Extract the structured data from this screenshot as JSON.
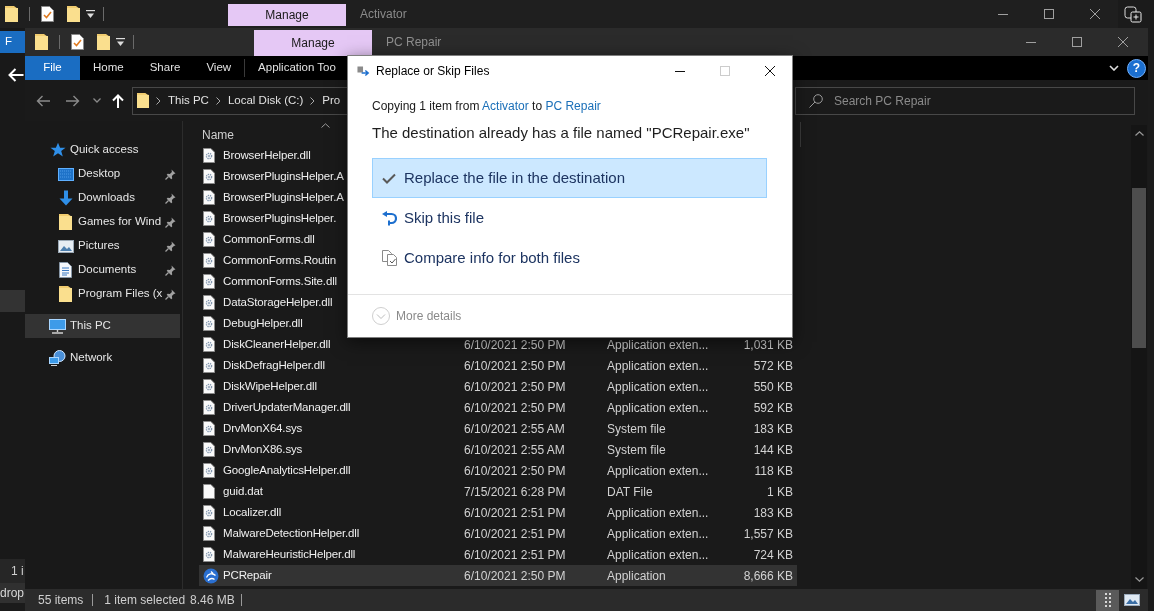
{
  "back_window": {
    "title": "Activator",
    "context_tab": "Manage",
    "ribbon_tab": "F",
    "status_text": "1 i"
  },
  "desktop": {
    "text": "drop"
  },
  "window": {
    "title": "PC Repair",
    "context_tab": "Manage",
    "ribbon_tabs": [
      {
        "label": "File",
        "kind": "menu"
      },
      {
        "label": "Home",
        "kind": "tab"
      },
      {
        "label": "Share",
        "kind": "tab"
      },
      {
        "label": "View",
        "kind": "tab"
      },
      {
        "label": "Application Too",
        "kind": "tab"
      }
    ],
    "help": "?",
    "breadcrumb": [
      "This PC",
      "Local Disk (C:)",
      "Pro"
    ],
    "search": {
      "placeholder": "Search PC Repair"
    },
    "nav": [
      {
        "label": "Quick access",
        "kind": "star",
        "selected": false,
        "children": [
          {
            "label": "Desktop",
            "kind": "desktop",
            "pinned": true,
            "selected": false
          },
          {
            "label": "Downloads",
            "kind": "downloads",
            "pinned": true,
            "selected": false
          },
          {
            "label": "Games for Wind",
            "kind": "folder",
            "pinned": true,
            "selected": false
          },
          {
            "label": "Pictures",
            "kind": "pictures",
            "pinned": true,
            "selected": false
          },
          {
            "label": "Documents",
            "kind": "documents",
            "pinned": true,
            "selected": false
          },
          {
            "label": "Program Files (x",
            "kind": "folder",
            "pinned": true,
            "selected": false
          }
        ]
      },
      {
        "label": "This PC",
        "kind": "computer",
        "selected": true
      },
      {
        "label": "Network",
        "kind": "network",
        "selected": false
      }
    ],
    "table": {
      "columns": [
        {
          "label": "Name",
          "ascending": true
        }
      ],
      "rows": [
        {
          "name": "BrowserHelper.dll",
          "kind": "extension",
          "selected": false
        },
        {
          "name": "BrowserPluginsHelper.A",
          "kind": "extension",
          "selected": false
        },
        {
          "name": "BrowserPluginsHelper.A",
          "kind": "extension",
          "selected": false
        },
        {
          "name": "BrowserPluginsHelper.",
          "kind": "extension",
          "selected": false
        },
        {
          "name": "CommonForms.dll",
          "kind": "extension",
          "selected": false
        },
        {
          "name": "CommonForms.Routin",
          "kind": "extension",
          "selected": false
        },
        {
          "name": "CommonForms.Site.dll",
          "kind": "extension",
          "selected": false
        },
        {
          "name": "DataStorageHelper.dll",
          "kind": "extension",
          "selected": false
        },
        {
          "name": "DebugHelper.dll",
          "kind": "extension",
          "selected": false
        },
        {
          "name": "DiskCleanerHelper.dll",
          "kind": "extension",
          "selected": false,
          "column_2": "6/10/2021 2:50 PM",
          "column_3": "Application exten...",
          "column_4": "1,031 KB"
        },
        {
          "name": "DiskDefragHelper.dll",
          "kind": "extension",
          "selected": false,
          "column_2": "6/10/2021 2:50 PM",
          "column_3": "Application exten...",
          "column_4": "572 KB"
        },
        {
          "name": "DiskWipeHelper.dll",
          "kind": "extension",
          "selected": false,
          "column_2": "6/10/2021 2:50 PM",
          "column_3": "Application exten...",
          "column_4": "550 KB"
        },
        {
          "name": "DriverUpdaterManager.dll",
          "kind": "extension",
          "selected": false,
          "column_2": "6/10/2021 2:50 PM",
          "column_3": "Application exten...",
          "column_4": "592 KB"
        },
        {
          "name": "DrvMonX64.sys",
          "kind": "extension",
          "selected": false,
          "column_2": "6/10/2021 2:55 AM",
          "column_3": "System file",
          "column_4": "183 KB"
        },
        {
          "name": "DrvMonX86.sys",
          "kind": "extension",
          "selected": false,
          "column_2": "6/10/2021 2:55 AM",
          "column_3": "System file",
          "column_4": "144 KB"
        },
        {
          "name": "GoogleAnalyticsHelper.dll",
          "kind": "extension",
          "selected": false,
          "column_2": "6/10/2021 2:50 PM",
          "column_3": "Application exten...",
          "column_4": "118 KB"
        },
        {
          "name": "guid.dat",
          "kind": "file",
          "selected": false,
          "column_2": "7/15/2021 6:28 PM",
          "column_3": "DAT File",
          "column_4": "1 KB"
        },
        {
          "name": "Localizer.dll",
          "kind": "extension",
          "selected": false,
          "column_2": "6/10/2021 2:51 PM",
          "column_3": "Application exten...",
          "column_4": "183 KB"
        },
        {
          "name": "MalwareDetectionHelper.dll",
          "kind": "extension",
          "selected": false,
          "column_2": "6/10/2021 2:51 PM",
          "column_3": "Application exten...",
          "column_4": "1,557 KB"
        },
        {
          "name": "MalwareHeuristicHelper.dll",
          "kind": "extension",
          "selected": false,
          "column_2": "6/10/2021 2:51 PM",
          "column_3": "Application exten...",
          "column_4": "724 KB"
        },
        {
          "name": "PCRepair",
          "kind": "application",
          "selected": true,
          "column_2": "6/10/2021 2:50 PM",
          "column_3": "Application",
          "column_4": "8,666 KB"
        }
      ]
    },
    "status_bar": {
      "item_count": "55 items",
      "selection": "1 item selected",
      "selection_size": "8.46 MB"
    },
    "views": [
      {
        "kind": "details",
        "selected": true
      },
      {
        "kind": "large_icons",
        "selected": false
      }
    ]
  },
  "dialog": {
    "title": "Replace or Skip Files",
    "controls": [
      {
        "kind": "minimize",
        "disabled": false
      },
      {
        "kind": "maximize",
        "disabled": true
      },
      {
        "kind": "close",
        "disabled": false
      }
    ],
    "copy_line": [
      {
        "text": "Copying 1 item from",
        "kind": "text"
      },
      {
        "text": "Activator",
        "kind": "link"
      },
      {
        "text": "to",
        "kind": "text"
      },
      {
        "text": "PC Repair",
        "kind": "link"
      }
    ],
    "heading": "The destination already has a file named \"PCRepair.exe\"",
    "options": [
      {
        "label": "Replace the file in the destination",
        "kind": "replace",
        "selected": true
      },
      {
        "label": "Skip this file",
        "kind": "skip",
        "selected": false
      },
      {
        "label": "Compare info for both files",
        "kind": "compare",
        "selected": false
      }
    ],
    "more_details": "More details"
  }
}
